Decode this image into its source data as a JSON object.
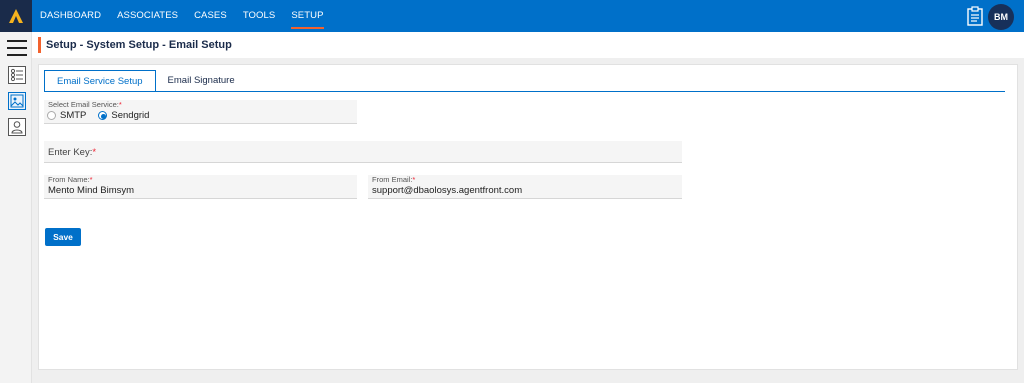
{
  "nav": {
    "items": [
      {
        "label": "DASHBOARD"
      },
      {
        "label": "ASSOCIATES"
      },
      {
        "label": "CASES"
      },
      {
        "label": "TOOLS"
      },
      {
        "label": "SETUP"
      }
    ],
    "active": "SETUP",
    "avatar_initials": "BM",
    "icons": [
      "app-logo-icon",
      "clipboard-icon"
    ]
  },
  "sidebar": {
    "icons": [
      "hamburger-icon",
      "list-settings-icon",
      "image-icon",
      "user-icon"
    ]
  },
  "breadcrumb": {
    "title": "Setup - System Setup - Email Setup"
  },
  "tabs": [
    {
      "label": "Email Service Setup",
      "active": true
    },
    {
      "label": "Email Signature",
      "active": false
    }
  ],
  "form": {
    "email_service": {
      "label": "Select Email Service:",
      "required_mark": "*",
      "options": [
        "SMTP",
        "Sendgrid"
      ],
      "selected": "Sendgrid"
    },
    "enter_key": {
      "placeholder": "Enter Key:",
      "required_mark": "*",
      "value": ""
    },
    "from_name": {
      "label": "From Name:",
      "required_mark": "*",
      "value": "Mento Mind Bimsym"
    },
    "from_email": {
      "label": "From Email:",
      "required_mark": "*",
      "value": "support@dbaolosys.agentfront.com"
    },
    "save_label": "Save"
  },
  "colors": {
    "primary": "#0070c9",
    "accent": "#f2622e",
    "nav_dark": "#1a2b4a"
  }
}
